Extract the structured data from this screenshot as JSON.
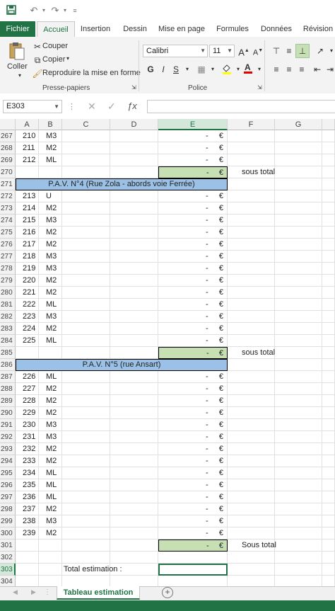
{
  "quick_access": {
    "save_icon": "save-icon",
    "undo_icon": "undo-icon",
    "redo_icon": "redo-icon",
    "customize_icon": "customize-icon"
  },
  "tabs": [
    {
      "label": "Fichier",
      "key": "file"
    },
    {
      "label": "Accueil",
      "key": "home"
    },
    {
      "label": "Insertion",
      "key": "insert"
    },
    {
      "label": "Dessin",
      "key": "draw"
    },
    {
      "label": "Mise en page",
      "key": "layout"
    },
    {
      "label": "Formules",
      "key": "formulas"
    },
    {
      "label": "Données",
      "key": "data"
    },
    {
      "label": "Révision",
      "key": "review"
    }
  ],
  "clipboard": {
    "paste": "Coller",
    "cut": "Couper",
    "copy": "Copier",
    "format_painter": "Reproduire la mise en forme",
    "group": "Presse-papiers"
  },
  "font": {
    "name": "Calibri",
    "size": "11",
    "bold": "G",
    "italic": "I",
    "underline": "S",
    "group": "Police"
  },
  "formula_bar": {
    "name_box": "E303",
    "formula": ""
  },
  "columns": [
    "A",
    "B",
    "C",
    "D",
    "E",
    "F",
    "G"
  ],
  "selected_column": "E",
  "rows": [
    {
      "n": "267",
      "a": "210",
      "b": "M3",
      "e": "-",
      "eur": "€"
    },
    {
      "n": "268",
      "a": "211",
      "b": "M2",
      "e": "-",
      "eur": "€"
    },
    {
      "n": "269",
      "a": "212",
      "b": "ML",
      "e": "-",
      "eur": "€"
    },
    {
      "n": "270",
      "subtotal": true,
      "e": "-",
      "eur": "€",
      "note": "sous total"
    },
    {
      "n": "271",
      "band": "P.A.V. N°4 (Rue Zola - abords voie Ferrée)"
    },
    {
      "n": "272",
      "a": "213",
      "b": "U",
      "e": "-",
      "eur": "€"
    },
    {
      "n": "273",
      "a": "214",
      "b": "M2",
      "e": "-",
      "eur": "€"
    },
    {
      "n": "274",
      "a": "215",
      "b": "M3",
      "e": "-",
      "eur": "€"
    },
    {
      "n": "275",
      "a": "216",
      "b": "M2",
      "e": "-",
      "eur": "€"
    },
    {
      "n": "276",
      "a": "217",
      "b": "M2",
      "e": "-",
      "eur": "€"
    },
    {
      "n": "277",
      "a": "218",
      "b": "M3",
      "e": "-",
      "eur": "€"
    },
    {
      "n": "278",
      "a": "219",
      "b": "M3",
      "e": "-",
      "eur": "€"
    },
    {
      "n": "279",
      "a": "220",
      "b": "M2",
      "e": "-",
      "eur": "€"
    },
    {
      "n": "280",
      "a": "221",
      "b": "M2",
      "e": "-",
      "eur": "€"
    },
    {
      "n": "281",
      "a": "222",
      "b": "ML",
      "e": "-",
      "eur": "€"
    },
    {
      "n": "282",
      "a": "223",
      "b": "M3",
      "e": "-",
      "eur": "€"
    },
    {
      "n": "283",
      "a": "224",
      "b": "M2",
      "e": "-",
      "eur": "€"
    },
    {
      "n": "284",
      "a": "225",
      "b": "ML",
      "e": "-",
      "eur": "€"
    },
    {
      "n": "285",
      "subtotal": true,
      "e": "-",
      "eur": "€",
      "note": "sous total"
    },
    {
      "n": "286",
      "band": "P.A.V. N°5 (rue Ansart)"
    },
    {
      "n": "287",
      "a": "226",
      "b": "ML",
      "e": "-",
      "eur": "€"
    },
    {
      "n": "288",
      "a": "227",
      "b": "M2",
      "e": "-",
      "eur": "€"
    },
    {
      "n": "289",
      "a": "228",
      "b": "M2",
      "e": "-",
      "eur": "€"
    },
    {
      "n": "290",
      "a": "229",
      "b": "M2",
      "e": "-",
      "eur": "€"
    },
    {
      "n": "291",
      "a": "230",
      "b": "M3",
      "e": "-",
      "eur": "€"
    },
    {
      "n": "292",
      "a": "231",
      "b": "M3",
      "e": "-",
      "eur": "€"
    },
    {
      "n": "293",
      "a": "232",
      "b": "M2",
      "e": "-",
      "eur": "€"
    },
    {
      "n": "294",
      "a": "233",
      "b": "M2",
      "e": "-",
      "eur": "€"
    },
    {
      "n": "295",
      "a": "234",
      "b": "ML",
      "e": "-",
      "eur": "€"
    },
    {
      "n": "296",
      "a": "235",
      "b": "ML",
      "e": "-",
      "eur": "€"
    },
    {
      "n": "297",
      "a": "236",
      "b": "ML",
      "e": "-",
      "eur": "€"
    },
    {
      "n": "298",
      "a": "237",
      "b": "M2",
      "e": "-",
      "eur": "€"
    },
    {
      "n": "299",
      "a": "238",
      "b": "M3",
      "e": "-",
      "eur": "€"
    },
    {
      "n": "300",
      "a": "239",
      "b": "M2",
      "e": "-",
      "eur": "€"
    },
    {
      "n": "301",
      "subtotal": true,
      "e": "-",
      "eur": "€",
      "note": "Sous total"
    },
    {
      "n": "302"
    },
    {
      "n": "303",
      "total_label": "Total estimation :",
      "selected": true
    },
    {
      "n": "304"
    }
  ],
  "sheet": {
    "active_tab": "Tableau estimation"
  },
  "colors": {
    "accent": "#217346",
    "subtotal": "#c6e0b4",
    "band": "#9bc2e6"
  }
}
